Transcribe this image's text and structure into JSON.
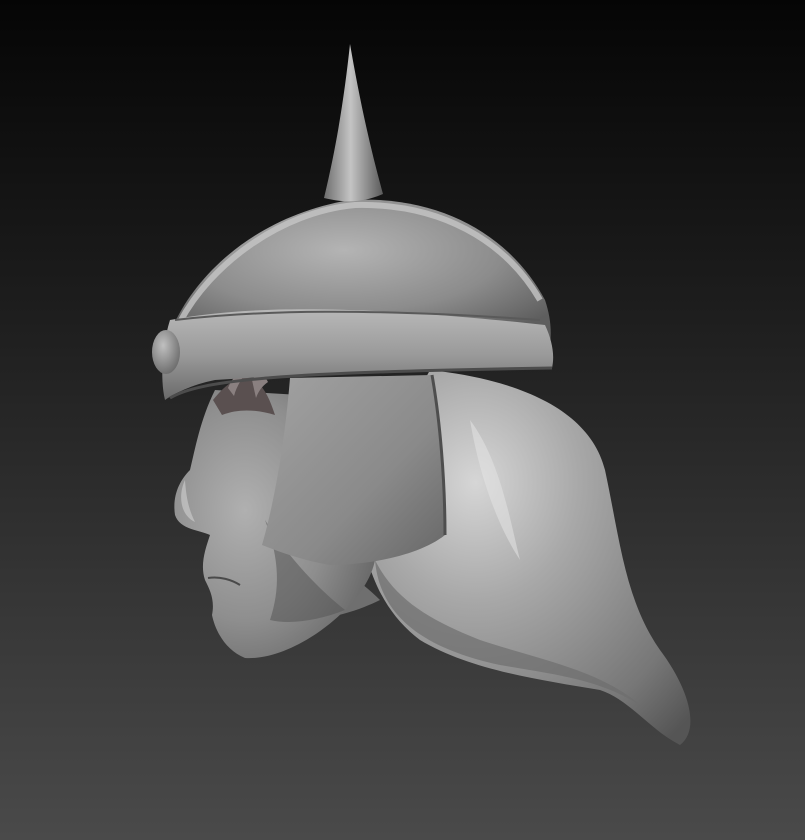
{
  "scene": {
    "background_top": "#050505",
    "background_bottom": "#4a4a4a",
    "material_base": "#8f8f8f",
    "material_highlight": "#c9c9c9",
    "material_shadow": "#3a3a3a",
    "detail_color": "#5a5050"
  }
}
